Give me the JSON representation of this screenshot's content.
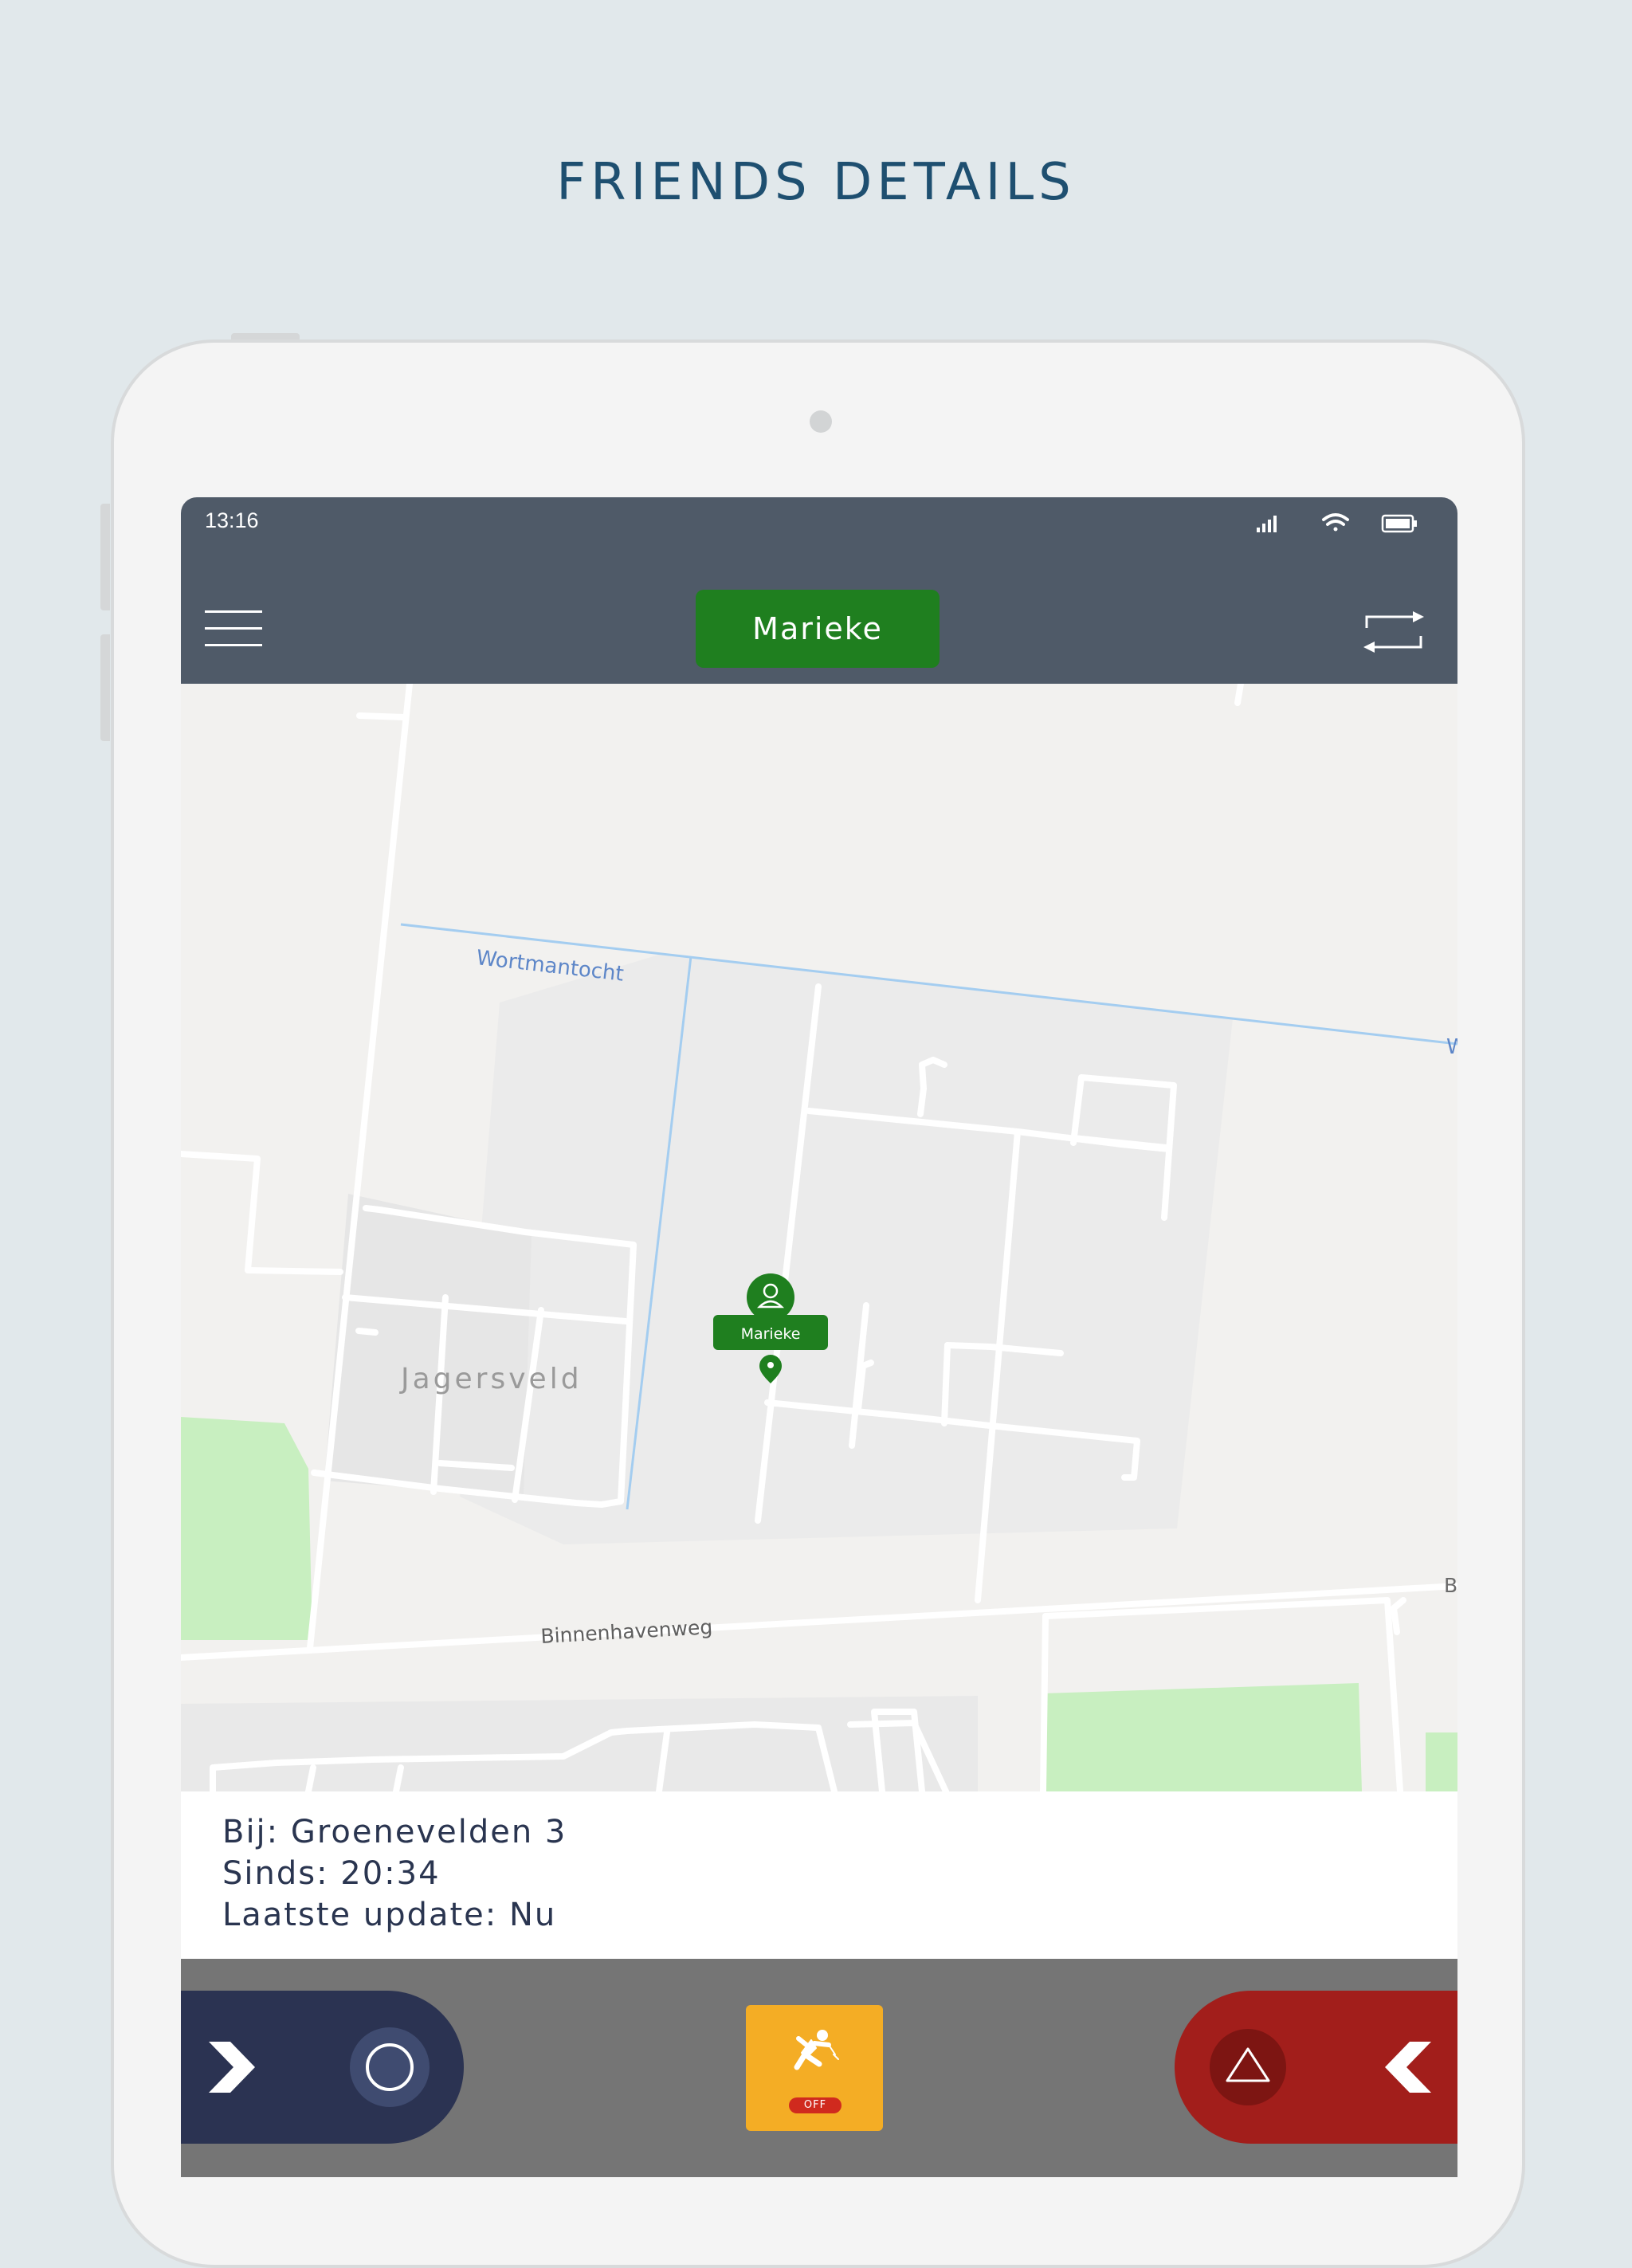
{
  "page": {
    "title": "FRIENDS DETAILS"
  },
  "status_bar": {
    "time": "13:16"
  },
  "header": {
    "friend_name": "Marieke"
  },
  "map": {
    "labels": {
      "waterway": "Wortmantocht",
      "waterway_edge": "W",
      "neighborhood": "Jagersveld",
      "road": "Binnenhavenweg",
      "road_edge": "B"
    },
    "marker": {
      "name": "Marieke"
    },
    "colors": {
      "land": "#f2f1ef",
      "block": "#e9e9e9",
      "park": "#c8efc0",
      "water": "#a4cdf0",
      "road": "#ffffff"
    }
  },
  "info": {
    "address": "Bij: Groenevelden 3",
    "since": "Sinds: 20:34",
    "last_update": "Laatste update: Nu"
  },
  "actions": {
    "fall_status": "OFF"
  },
  "colors": {
    "accent_green": "#1f7f1f",
    "topbar": "#4f5a68",
    "left_pill": "#2b3352",
    "right_pill": "#a21e1b",
    "fall_button": "#f4ad25"
  },
  "icons": [
    "menu-icon",
    "switch-icon",
    "person-icon",
    "map-pin-icon",
    "chevron-right-icon",
    "circle-icon",
    "triangle-icon",
    "chevron-left-icon",
    "fall-person-icon",
    "signal-icon",
    "wifi-icon",
    "battery-icon"
  ]
}
